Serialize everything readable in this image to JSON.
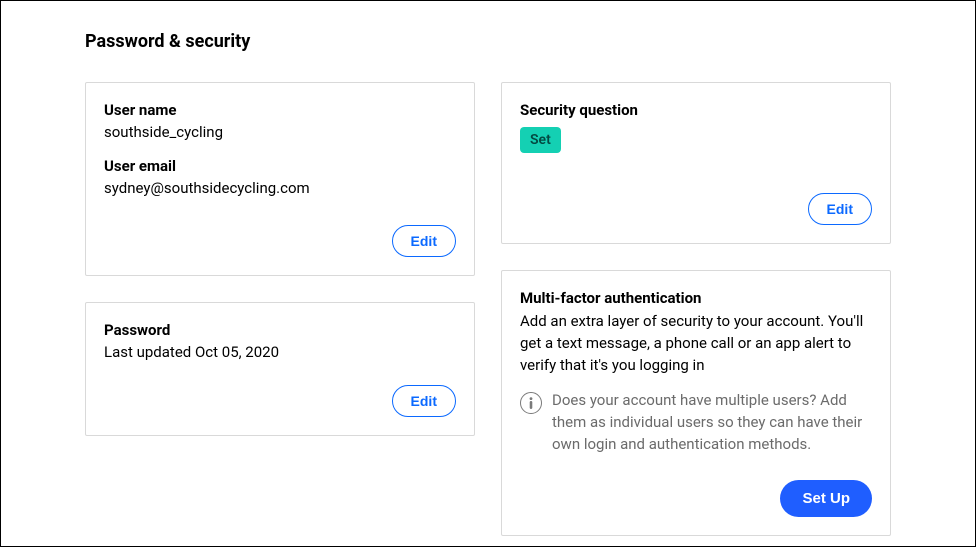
{
  "page": {
    "title": "Password & security"
  },
  "user_card": {
    "username_label": "User name",
    "username_value": "southside_cycling",
    "email_label": "User email",
    "email_value": "sydney@southsidecycling.com",
    "edit_label": "Edit"
  },
  "password_card": {
    "label": "Password",
    "value": "Last updated Oct 05, 2020",
    "edit_label": "Edit"
  },
  "security_question_card": {
    "label": "Security question",
    "status_badge": "Set",
    "edit_label": "Edit"
  },
  "mfa_card": {
    "label": "Multi-factor authentication",
    "description": "Add an extra layer of security to your account. You'll get a text message, a phone call or an app alert to verify that it's you logging in",
    "info_text": "Does your account have multiple users? Add them as individual users so they can have their own login and authentication methods.",
    "setup_label": "Set Up"
  }
}
